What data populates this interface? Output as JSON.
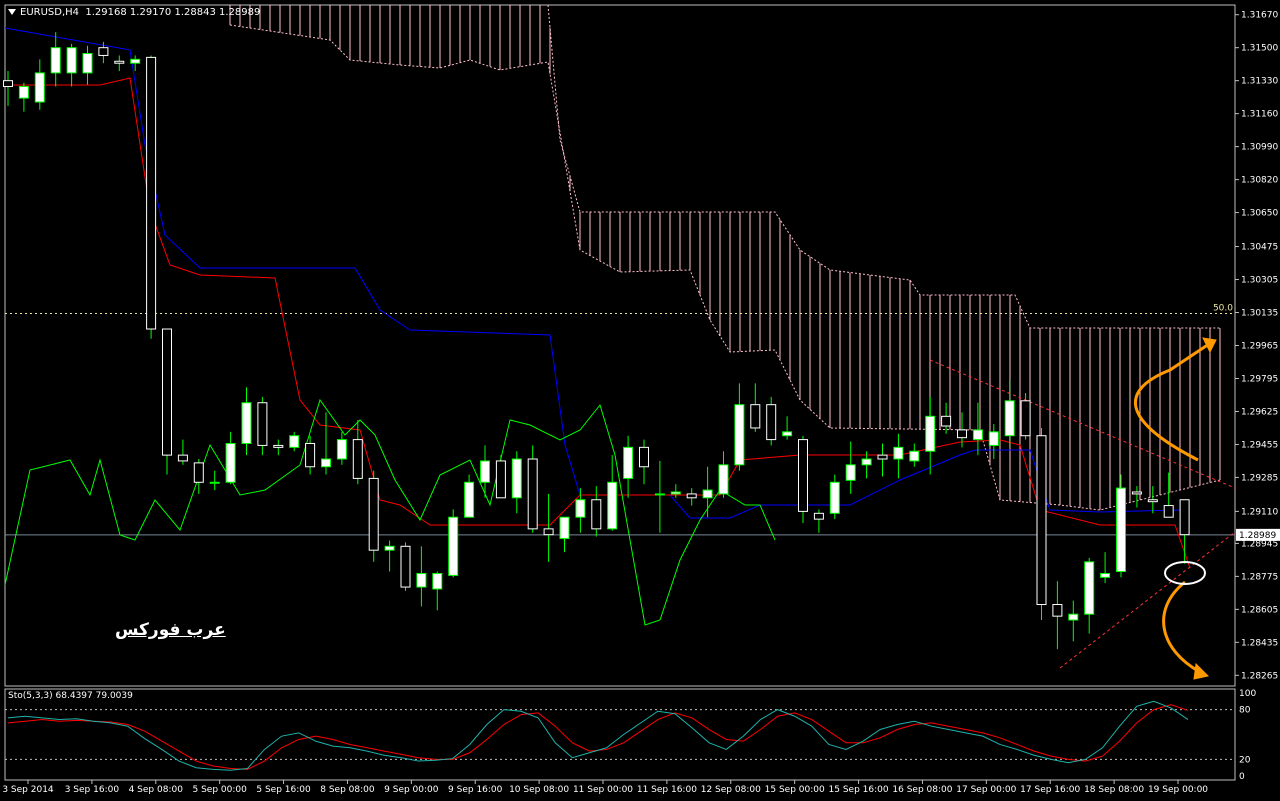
{
  "header": {
    "symbol": "EURUSD,H4",
    "open": "1.29168",
    "high": "1.29170",
    "low": "1.28843",
    "close": "1.28989"
  },
  "watermark": "عرب فوركس",
  "colors": {
    "background": "#000000",
    "bull": "#ffffff",
    "bear": "#ffffff",
    "wick": "#00ff00",
    "kijun": "#0000ff",
    "tenkan": "#ff0000",
    "chikou": "#00ff00",
    "cloud": "#ffc0cb",
    "arrow": "#ff9900",
    "stoch_main": "#20b2aa",
    "stoch_signal": "#ff0000",
    "price_line": "#778899"
  },
  "chart_data": [
    {
      "type": "candlestick",
      "symbol": "EURUSD",
      "timeframe": "H4",
      "current_price": "1.28989",
      "level_label": "50.0",
      "level_value": 1.3013,
      "ylim": [
        1.2821,
        1.3172
      ],
      "y_ticks": [
        "1.31670",
        "1.31500",
        "1.31330",
        "1.31160",
        "1.30990",
        "1.30820",
        "1.30650",
        "1.30475",
        "1.30305",
        "1.30135",
        "1.29965",
        "1.29795",
        "1.29625",
        "1.29455",
        "1.29285",
        "1.29110",
        "1.28945",
        "1.28775",
        "1.28605",
        "1.28435",
        "1.28265"
      ],
      "x_ticks": [
        "3 Sep 2014",
        "3 Sep 16:00",
        "4 Sep 08:00",
        "5 Sep 00:00",
        "5 Sep 16:00",
        "8 Sep 08:00",
        "9 Sep 00:00",
        "9 Sep 16:00",
        "10 Sep 08:00",
        "11 Sep 00:00",
        "11 Sep 16:00",
        "12 Sep 08:00",
        "15 Sep 00:00",
        "15 Sep 16:00",
        "16 Sep 08:00",
        "17 Sep 00:00",
        "17 Sep 16:00",
        "18 Sep 08:00",
        "19 Sep 00:00"
      ],
      "candles": [
        [
          1.3133,
          1.3138,
          1.312,
          1.313
        ],
        [
          1.3124,
          1.3132,
          1.3117,
          1.313
        ],
        [
          1.3122,
          1.3144,
          1.3118,
          1.3137
        ],
        [
          1.3137,
          1.3158,
          1.313,
          1.315
        ],
        [
          1.3137,
          1.3152,
          1.313,
          1.315
        ],
        [
          1.3137,
          1.3151,
          1.3131,
          1.3147
        ],
        [
          1.315,
          1.3153,
          1.3142,
          1.3146
        ],
        [
          1.3143,
          1.3146,
          1.3138,
          1.3142
        ],
        [
          1.3142,
          1.3146,
          1.3138,
          1.3144
        ],
        [
          1.3145,
          1.3146,
          1.3,
          1.3005
        ],
        [
          1.3005,
          1.3005,
          1.293,
          1.294
        ],
        [
          1.294,
          1.2948,
          1.2935,
          1.2937
        ],
        [
          1.2936,
          1.2938,
          1.292,
          1.2926
        ],
        [
          1.2926,
          1.2932,
          1.2922,
          1.2926
        ],
        [
          1.2926,
          1.2952,
          1.2925,
          1.2946
        ],
        [
          1.2946,
          1.2975,
          1.294,
          1.2967
        ],
        [
          1.2967,
          1.297,
          1.294,
          1.2945
        ],
        [
          1.2945,
          1.2948,
          1.294,
          1.2944
        ],
        [
          1.2944,
          1.2952,
          1.2942,
          1.295
        ],
        [
          1.2946,
          1.295,
          1.293,
          1.2934
        ],
        [
          1.2934,
          1.2962,
          1.293,
          1.2938
        ],
        [
          1.2938,
          1.2952,
          1.2935,
          1.2948
        ],
        [
          1.2948,
          1.2958,
          1.2925,
          1.2928
        ],
        [
          1.2928,
          1.2932,
          1.2885,
          1.2891
        ],
        [
          1.2891,
          1.2896,
          1.288,
          1.2893
        ],
        [
          1.2893,
          1.2895,
          1.287,
          1.2872
        ],
        [
          1.2872,
          1.2893,
          1.2862,
          1.2879
        ],
        [
          1.2871,
          1.288,
          1.286,
          1.2879
        ],
        [
          1.2878,
          1.2912,
          1.2877,
          1.2908
        ],
        [
          1.2908,
          1.293,
          1.2908,
          1.2926
        ],
        [
          1.2926,
          1.2945,
          1.2918,
          1.2937
        ],
        [
          1.2937,
          1.294,
          1.2918,
          1.2918
        ],
        [
          1.2918,
          1.2942,
          1.291,
          1.2938
        ],
        [
          1.2938,
          1.2945,
          1.29,
          1.2902
        ],
        [
          1.2902,
          1.292,
          1.2885,
          1.2899
        ],
        [
          1.2897,
          1.2908,
          1.289,
          1.2908
        ],
        [
          1.2908,
          1.2923,
          1.29,
          1.2917
        ],
        [
          1.2917,
          1.2924,
          1.2898,
          1.2902
        ],
        [
          1.2902,
          1.294,
          1.2901,
          1.2926
        ],
        [
          1.2928,
          1.295,
          1.2918,
          1.2944
        ],
        [
          1.2944,
          1.2948,
          1.2925,
          1.2934
        ],
        [
          1.292,
          1.2937,
          1.29,
          1.292
        ],
        [
          1.292,
          1.2925,
          1.2918,
          1.2921
        ],
        [
          1.292,
          1.2923,
          1.2914,
          1.2918
        ],
        [
          1.2918,
          1.2934,
          1.2908,
          1.2922
        ],
        [
          1.292,
          1.2942,
          1.2918,
          1.2935
        ],
        [
          1.2935,
          1.2977,
          1.2932,
          1.2966
        ],
        [
          1.2966,
          1.2977,
          1.2952,
          1.2954
        ],
        [
          1.2966,
          1.297,
          1.2945,
          1.2948
        ],
        [
          1.295,
          1.296,
          1.2948,
          1.2952
        ],
        [
          1.2948,
          1.295,
          1.2905,
          1.2911
        ],
        [
          1.291,
          1.2912,
          1.29,
          1.2907
        ],
        [
          1.291,
          1.293,
          1.2907,
          1.2926
        ],
        [
          1.2927,
          1.2947,
          1.292,
          1.2935
        ],
        [
          1.2935,
          1.2942,
          1.2928,
          1.2938
        ],
        [
          1.294,
          1.2946,
          1.2929,
          1.2938
        ],
        [
          1.2938,
          1.2951,
          1.2928,
          1.2944
        ],
        [
          1.2937,
          1.2946,
          1.2934,
          1.2942
        ],
        [
          1.2942,
          1.297,
          1.293,
          1.296
        ],
        [
          1.296,
          1.2967,
          1.2951,
          1.2955
        ],
        [
          1.2953,
          1.2962,
          1.2944,
          1.2949
        ],
        [
          1.2948,
          1.2967,
          1.294,
          1.2953
        ],
        [
          1.2945,
          1.2956,
          1.2938,
          1.2952
        ],
        [
          1.295,
          1.2979,
          1.2944,
          1.2968
        ],
        [
          1.2968,
          1.2972,
          1.2948,
          1.295
        ],
        [
          1.295,
          1.2954,
          1.2855,
          1.2863
        ],
        [
          1.2863,
          1.2875,
          1.284,
          1.2857
        ],
        [
          1.2855,
          1.2865,
          1.2844,
          1.2858
        ],
        [
          1.2858,
          1.2887,
          1.2848,
          1.2885
        ],
        [
          1.2877,
          1.289,
          1.2874,
          1.2879
        ],
        [
          1.288,
          1.293,
          1.2877,
          1.2923
        ],
        [
          1.2921,
          1.2924,
          1.2913,
          1.292
        ],
        [
          1.2917,
          1.2924,
          1.291,
          1.2916
        ],
        [
          1.2914,
          1.2931,
          1.2908,
          1.2908
        ],
        [
          1.2917,
          1.2917,
          1.2884,
          1.2899
        ]
      ]
    },
    {
      "type": "line",
      "name": "Sto(5,3,3)",
      "main_value": "68.4397",
      "signal_value": "79.0039",
      "ylim": [
        0,
        100
      ],
      "y_ticks": [
        "100",
        "80",
        "20",
        "0"
      ],
      "main": [
        70,
        72,
        70,
        68,
        69,
        66,
        64,
        60,
        45,
        32,
        18,
        10,
        8,
        7,
        9,
        32,
        48,
        52,
        42,
        36,
        34,
        30,
        25,
        22,
        18,
        19,
        21,
        38,
        62,
        80,
        78,
        70,
        40,
        22,
        28,
        34,
        50,
        64,
        78,
        75,
        58,
        40,
        32,
        48,
        68,
        80,
        72,
        60,
        38,
        32,
        42,
        56,
        62,
        66,
        60,
        56,
        52,
        48,
        38,
        32,
        25,
        20,
        16,
        20,
        34,
        60,
        84,
        90,
        82,
        68
      ],
      "signal": [
        64,
        66,
        68,
        66,
        67,
        66,
        65,
        62,
        54,
        42,
        30,
        18,
        12,
        9,
        8,
        18,
        34,
        44,
        48,
        44,
        38,
        34,
        30,
        26,
        22,
        20,
        20,
        28,
        44,
        62,
        74,
        76,
        60,
        40,
        30,
        32,
        40,
        54,
        68,
        76,
        70,
        56,
        44,
        42,
        56,
        72,
        76,
        68,
        54,
        40,
        40,
        46,
        56,
        62,
        64,
        60,
        56,
        52,
        46,
        38,
        30,
        24,
        20,
        18,
        24,
        42,
        64,
        80,
        86,
        79
      ]
    }
  ]
}
